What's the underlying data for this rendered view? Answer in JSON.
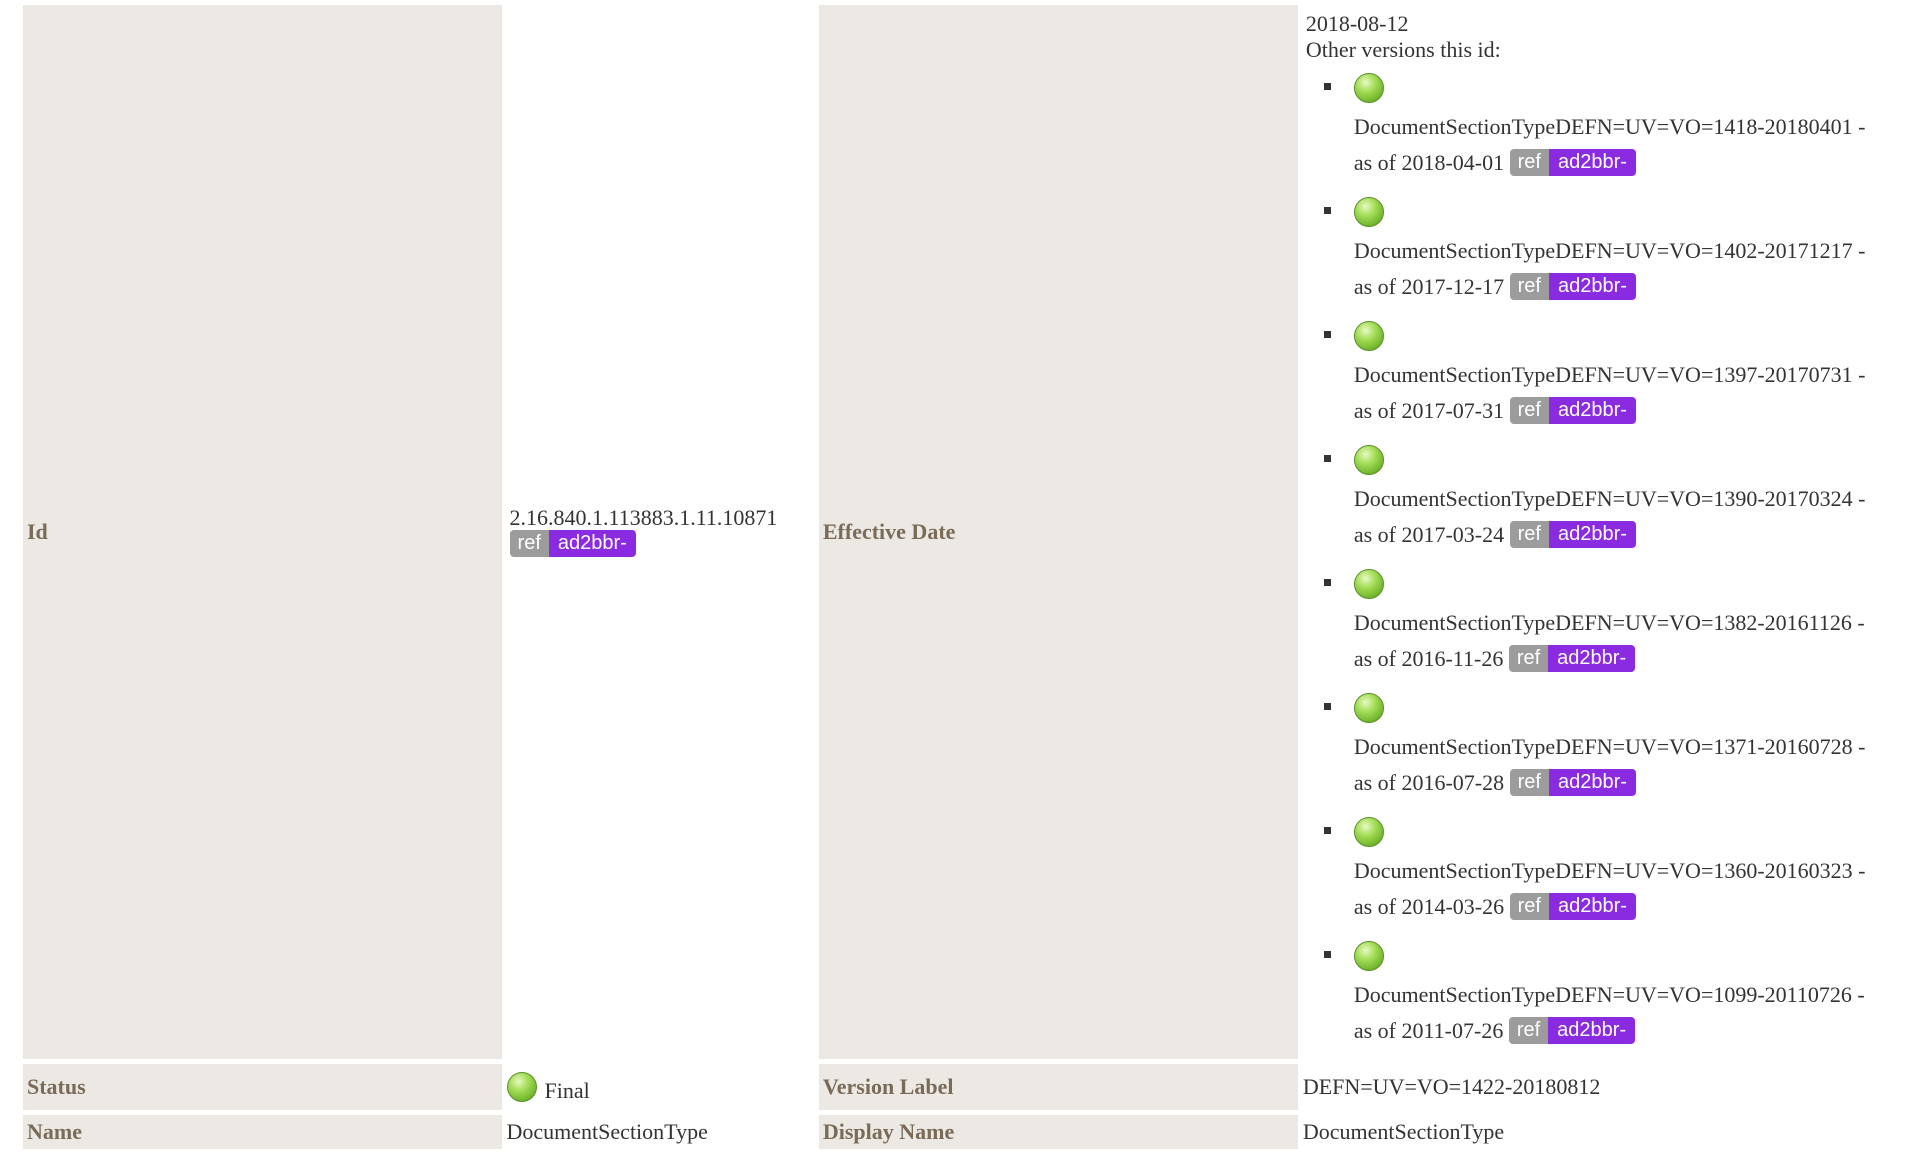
{
  "rows": {
    "id": {
      "label": "Id",
      "value": "2.16.840.1.113883.1.11.10871",
      "badge_ref": "ref",
      "badge_prefix": "ad2bbr-"
    },
    "effective_date": {
      "label": "Effective Date",
      "value": "2018-08-12",
      "other_versions_label": "Other versions this id:",
      "versions": [
        {
          "name": "DocumentSectionTypeDEFN=UV=VO=1418-20180401 -",
          "as_of": "as of 2018-04-01",
          "badge_ref": "ref",
          "badge_prefix": "ad2bbr-"
        },
        {
          "name": "DocumentSectionTypeDEFN=UV=VO=1402-20171217 -",
          "as_of": "as of 2017-12-17",
          "badge_ref": "ref",
          "badge_prefix": "ad2bbr-"
        },
        {
          "name": "DocumentSectionTypeDEFN=UV=VO=1397-20170731 -",
          "as_of": "as of 2017-07-31",
          "badge_ref": "ref",
          "badge_prefix": "ad2bbr-"
        },
        {
          "name": "DocumentSectionTypeDEFN=UV=VO=1390-20170324 -",
          "as_of": "as of 2017-03-24",
          "badge_ref": "ref",
          "badge_prefix": "ad2bbr-"
        },
        {
          "name": "DocumentSectionTypeDEFN=UV=VO=1382-20161126 -",
          "as_of": "as of 2016-11-26",
          "badge_ref": "ref",
          "badge_prefix": "ad2bbr-"
        },
        {
          "name": "DocumentSectionTypeDEFN=UV=VO=1371-20160728 -",
          "as_of": "as of 2016-07-28",
          "badge_ref": "ref",
          "badge_prefix": "ad2bbr-"
        },
        {
          "name": "DocumentSectionTypeDEFN=UV=VO=1360-20160323 -",
          "as_of": "as of 2014-03-26",
          "badge_ref": "ref",
          "badge_prefix": "ad2bbr-"
        },
        {
          "name": "DocumentSectionTypeDEFN=UV=VO=1099-20110726 -",
          "as_of": "as of 2011-07-26",
          "badge_ref": "ref",
          "badge_prefix": "ad2bbr-"
        }
      ]
    },
    "status": {
      "label": "Status",
      "value": "Final",
      "icon": "status-final-green-dot-icon"
    },
    "version_label": {
      "label": "Version Label",
      "value": "DEFN=UV=VO=1422-20180812"
    },
    "name": {
      "label": "Name",
      "value": "DocumentSectionType"
    },
    "display_name": {
      "label": "Display Name",
      "value": "DocumentSectionType"
    }
  },
  "colors": {
    "label_background": "#ece9e4",
    "label_text": "#7a6b58",
    "badge_ref": "#9c9c9c",
    "badge_prefix": "#8a2be2",
    "status_final": "#8fd14f"
  }
}
